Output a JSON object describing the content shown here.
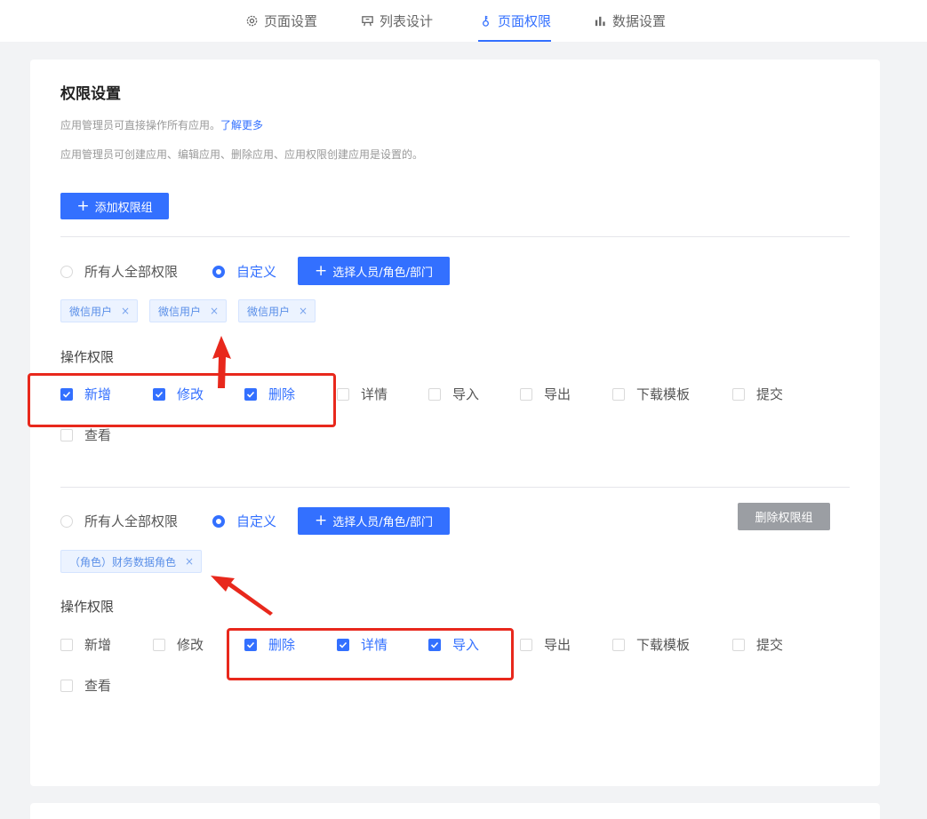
{
  "tabs": [
    {
      "label": "页面设置",
      "icon": "gear-icon"
    },
    {
      "label": "列表设计",
      "icon": "list-design-icon"
    },
    {
      "label": "页面权限",
      "icon": "key-icon"
    },
    {
      "label": "数据设置",
      "icon": "bar-chart-icon"
    }
  ],
  "active_tab": "页面权限",
  "colors": {
    "accent": "#3370ff",
    "annotation": "#e8281c",
    "gray_button": "#9b9ea3"
  },
  "settings": {
    "title": "权限设置",
    "desc1": "应用管理员可直接操作所有应用。",
    "learn_more": "了解更多",
    "desc2": "应用管理员可创建应用、编辑应用、删除应用、应用权限创建应用是设置的。",
    "add_group": "添加权限组"
  },
  "groups": [
    {
      "radio_all": "所有人全部权限",
      "radio_custom": "自定义",
      "select_btn": "选择人员/角色/部门",
      "tags": [
        "微信用户",
        "微信用户",
        "微信用户"
      ],
      "ops_label": "操作权限",
      "ops": [
        {
          "label": "新增",
          "checked": true
        },
        {
          "label": "修改",
          "checked": true
        },
        {
          "label": "删除",
          "checked": true
        },
        {
          "label": "详情",
          "checked": false
        },
        {
          "label": "导入",
          "checked": false
        },
        {
          "label": "导出",
          "checked": false
        },
        {
          "label": "下载模板",
          "checked": false
        },
        {
          "label": "提交",
          "checked": false
        },
        {
          "label": "查看",
          "checked": false
        }
      ]
    },
    {
      "radio_all": "所有人全部权限",
      "radio_custom": "自定义",
      "select_btn": "选择人员/角色/部门",
      "delete_group": "删除权限组",
      "tags": [
        "（角色）财务数据角色"
      ],
      "ops_label": "操作权限",
      "ops": [
        {
          "label": "新增",
          "checked": false
        },
        {
          "label": "修改",
          "checked": false
        },
        {
          "label": "删除",
          "checked": true
        },
        {
          "label": "详情",
          "checked": true
        },
        {
          "label": "导入",
          "checked": true
        },
        {
          "label": "导出",
          "checked": false
        },
        {
          "label": "下载模板",
          "checked": false
        },
        {
          "label": "提交",
          "checked": false
        },
        {
          "label": "查看",
          "checked": false
        }
      ]
    }
  ]
}
